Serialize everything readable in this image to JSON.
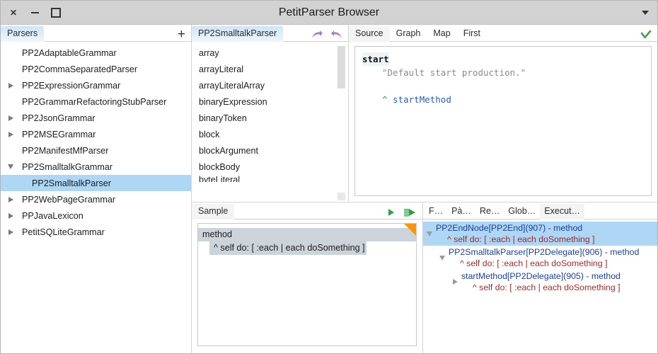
{
  "window": {
    "title": "PetitParser Browser",
    "controls": {
      "close": "✕",
      "minimize": "–",
      "maximize": "□"
    },
    "menu_icon": "chevron-down-icon"
  },
  "parsers_panel": {
    "tab_label": "Parsers",
    "add_button": "+",
    "items": [
      {
        "label": "PP2AdaptableGrammar",
        "twisty": "none",
        "level": 0,
        "selected": false
      },
      {
        "label": "PP2CommaSeparatedParser",
        "twisty": "none",
        "level": 0,
        "selected": false
      },
      {
        "label": "PP2ExpressionGrammar",
        "twisty": "closed",
        "level": 0,
        "selected": false
      },
      {
        "label": "PP2GrammarRefactoringStubParser",
        "twisty": "none",
        "level": 0,
        "selected": false
      },
      {
        "label": "PP2JsonGrammar",
        "twisty": "closed",
        "level": 0,
        "selected": false
      },
      {
        "label": "PP2MSEGrammar",
        "twisty": "closed",
        "level": 0,
        "selected": false
      },
      {
        "label": "PP2ManifestMfParser",
        "twisty": "none",
        "level": 0,
        "selected": false
      },
      {
        "label": "PP2SmalltalkGrammar",
        "twisty": "open",
        "level": 0,
        "selected": false
      },
      {
        "label": "PP2SmalltalkParser",
        "twisty": "none",
        "level": 1,
        "selected": true
      },
      {
        "label": "PP2WebPageGrammar",
        "twisty": "closed",
        "level": 0,
        "selected": false
      },
      {
        "label": "PPJavaLexicon",
        "twisty": "closed",
        "level": 0,
        "selected": false
      },
      {
        "label": "PetitSQLiteGrammar",
        "twisty": "closed",
        "level": 0,
        "selected": false
      }
    ]
  },
  "methods_panel": {
    "tab_label": "PP2SmalltalkParser",
    "icons": [
      "forward-arrow-icon",
      "back-arrow-icon"
    ],
    "items": [
      "array",
      "arrayLiteral",
      "arrayLiteralArray",
      "binaryExpression",
      "binaryToken",
      "block",
      "blockArgument",
      "blockBody"
    ],
    "clipped_item": "byteLiteral"
  },
  "source_panel": {
    "tabs": [
      {
        "label": "Source",
        "active": true
      },
      {
        "label": "Graph",
        "active": false
      },
      {
        "label": "Map",
        "active": false
      },
      {
        "label": "First",
        "active": false
      }
    ],
    "status_icon": "checkmark-icon",
    "code": {
      "selector": "start",
      "comment": "\"Default start production.\"",
      "return_caret": "^",
      "return_value": "startMethod"
    }
  },
  "sample_panel": {
    "tab_label": "Sample",
    "icons": [
      "run-icon",
      "run-step-icon"
    ],
    "corner_marker": "unsaved-changes-marker",
    "text_line1": "method",
    "text_line2": "^ self do: [ :each | each doSomething ]"
  },
  "execution_panel": {
    "tabs": [
      {
        "label": "F…",
        "active": false
      },
      {
        "label": "Pà…",
        "active": false
      },
      {
        "label": "Re…",
        "active": false
      },
      {
        "label": "Glob…",
        "active": false
      },
      {
        "label": "Execut…",
        "active": true
      }
    ],
    "nodes": [
      {
        "twisty": "open",
        "indent": 0,
        "selected": true,
        "title": "PP2EndNode[PP2End](907) - method",
        "detail": "^ self do: [ :each | each doSomething ]"
      },
      {
        "twisty": "open",
        "indent": 1,
        "selected": false,
        "title": "PP2SmalltalkParser[PP2Delegate](906) - method",
        "detail": "^ self do: [ :each | each doSomething ]"
      },
      {
        "twisty": "closed",
        "indent": 2,
        "selected": false,
        "title": "startMethod[PP2Delegate](905) - method",
        "detail": "^ self do: [ :each | each doSomething ]"
      }
    ]
  },
  "colors": {
    "selection": "#aed6f5",
    "titlebar": "#d2d2d2",
    "tab_active": "#cfe4f7",
    "node_title": "#1c3f94",
    "node_detail": "#9c2a2a",
    "accent_orange": "#ff9500",
    "accent_green": "#34a043",
    "accent_purple": "#a57fc4"
  }
}
